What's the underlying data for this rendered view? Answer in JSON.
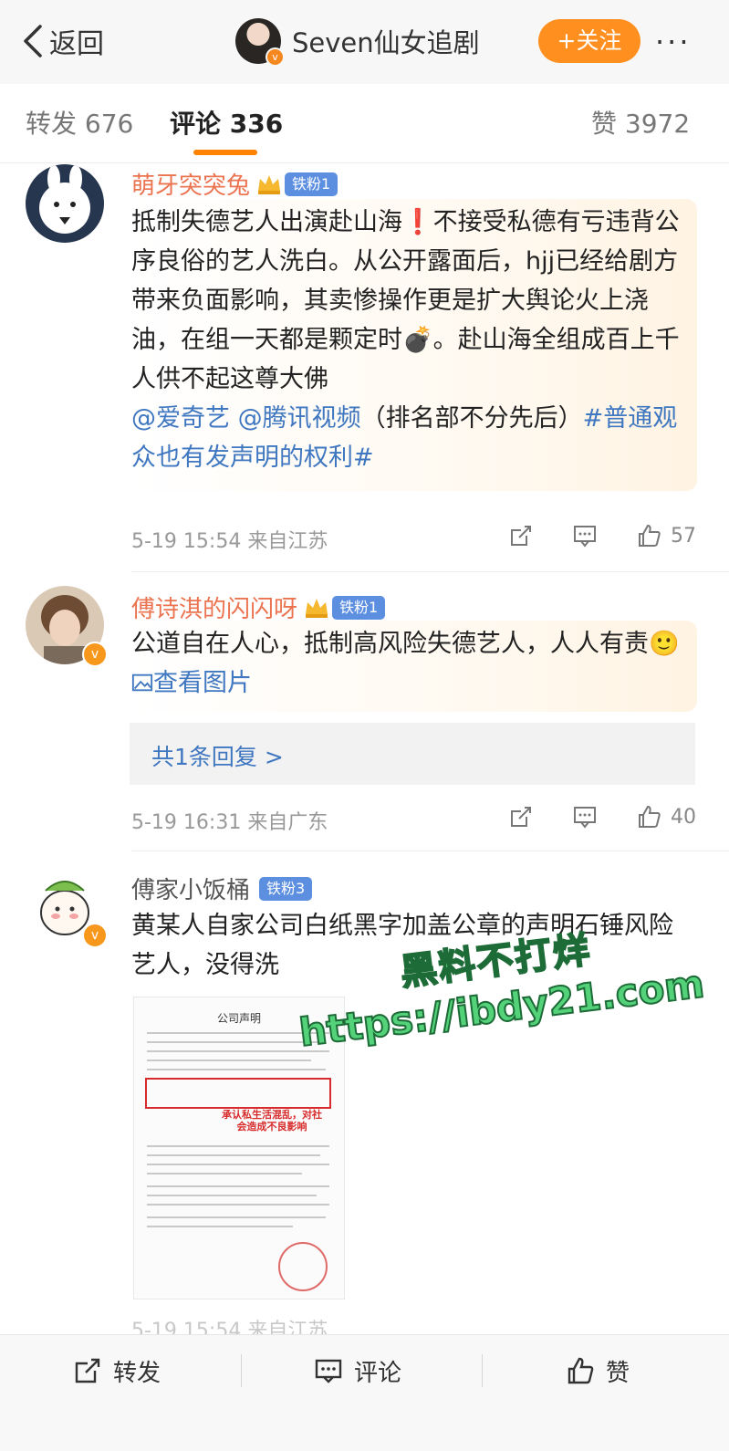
{
  "header": {
    "back_label": "返回",
    "author_name": "Seven仙女追剧",
    "follow_label": "+关注",
    "more_label": "···"
  },
  "tabs": [
    {
      "label": "转发 676"
    },
    {
      "label": "评论 336"
    },
    {
      "label": "赞 3972"
    }
  ],
  "comments": [
    {
      "username": "萌牙突突兔",
      "fan_badge": "铁粉1",
      "text_before": "抵制失德艺人出演赴山海",
      "exclaim": "❗",
      "text_mid": "不接受私德有亏违背公序良俗的艺人洗白。从公开露面后，hjj已经给剧方带来负面影响，其卖惨操作更是扩大舆论火上浇油，在组一天都是颗定时",
      "bomb": "💣",
      "text_after": "。赴山海全组成百上千人供不起这尊大佛",
      "mention1": "@爱奇艺",
      "mention2": "@腾讯视频",
      "paren": "（排名部不分先后）",
      "hashtag": "#普通观众也有发声明的权利#",
      "time": "5-19 15:54 来自江苏",
      "likes": "57"
    },
    {
      "username": "傅诗淇的闪闪呀",
      "fan_badge": "铁粉1",
      "text": "公道自在人心，抵制高风险失德艺人，人人有责",
      "emoji": "🙂",
      "view_image": "查看图片",
      "reply_summary": "共1条回复 >",
      "time": "5-19 16:31 来自广东",
      "likes": "40"
    },
    {
      "username": "傅家小饭桶",
      "fan_badge": "铁粉3",
      "text": "黄某人自家公司白纸黑字加盖公章的声明石锤风险艺人，没得洗",
      "image": {
        "doc_title": "公司声明",
        "doc_note": "承认私生活混乱，对社会造成不良影响"
      },
      "partial_meta": "5-19 15:54 来自江苏"
    }
  ],
  "watermark": {
    "line1": "黑料不打烊",
    "line2": "https://ibdy21.com"
  },
  "bottom_bar": {
    "repost_label": "转发",
    "comment_label": "评论",
    "like_label": "赞"
  },
  "colors": {
    "accent": "#ff8200",
    "username": "#eb7350",
    "link": "#3f77c0",
    "fan_badge": "#5d8fe0",
    "watermark": "#54d27a"
  }
}
